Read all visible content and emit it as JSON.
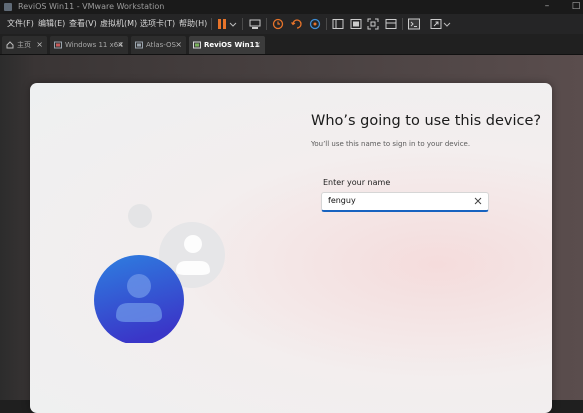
{
  "window": {
    "title": "ReviOS Win11 - VMware Workstation"
  },
  "menu": {
    "items": [
      "文件(F)",
      "编辑(E)",
      "查看(V)",
      "虚拟机(M)",
      "选项卡(T)",
      "帮助(H)"
    ]
  },
  "toolbar": {
    "icons": [
      "pause-icon",
      "dropdown-icon",
      "send-keys-icon",
      "snapshot-icon",
      "revert-snapshot-icon",
      "snapshot-manager-icon",
      "library-icon",
      "console-view-icon",
      "fullscreen-icon",
      "unity-icon",
      "terminal-icon",
      "stretch-icon"
    ],
    "accent_color": "#e8742a"
  },
  "tabs": [
    {
      "label": "主页",
      "icon": "home-icon",
      "active": false
    },
    {
      "label": "Windows 11 x64",
      "icon": "vm-icon",
      "active": false
    },
    {
      "label": "Atlas-OS",
      "icon": "vm-icon",
      "active": false
    },
    {
      "label": "ReviOS Win11",
      "icon": "vm-icon",
      "active": true
    }
  ],
  "oobe": {
    "heading": "Who’s going to use this device?",
    "subtext": "You’ll use this name to sign in to your device.",
    "field_label": "Enter your name",
    "name_value": "fenguy",
    "accent_color": "#1763c0"
  }
}
